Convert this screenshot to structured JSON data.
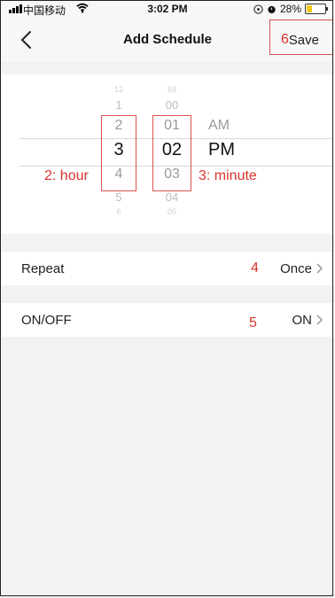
{
  "status_bar": {
    "carrier": "中国移动",
    "time": "3:02 PM",
    "battery": "28%",
    "battery_level": 0.28,
    "icons": [
      "signal-icon",
      "wifi-icon",
      "location-icon",
      "alarm-icon",
      "battery-icon"
    ]
  },
  "nav": {
    "back_icon": "chevron-left-icon",
    "title": "Add Schedule",
    "save_label": "Save"
  },
  "picker": {
    "hours": [
      "12",
      "1",
      "2",
      "3",
      "4",
      "5",
      "6"
    ],
    "minutes": [
      "59",
      "00",
      "01",
      "02",
      "03",
      "04",
      "05"
    ],
    "selected_hour": "3",
    "selected_minute": "02",
    "meridiem": {
      "am": "AM",
      "pm": "PM",
      "selected": "PM"
    }
  },
  "rows": [
    {
      "label": "Repeat",
      "value": "Once"
    },
    {
      "label": "ON/OFF",
      "value": "ON"
    }
  ],
  "annotations": {
    "hour": "2: hour",
    "minute": "3: minute",
    "repeat": "4",
    "onoff": "5",
    "save": "6",
    "color": "#d9342b"
  }
}
